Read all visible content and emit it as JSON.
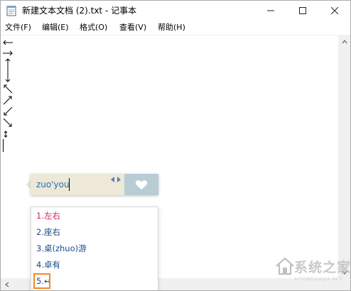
{
  "window": {
    "title": "新建文本文档 (2).txt - 记事本",
    "minimize_icon": "minimize-icon",
    "maximize_icon": "maximize-icon",
    "close_icon": "close-icon"
  },
  "menu": {
    "file": "文件(F)",
    "edit": "编辑(E)",
    "format": "格式(O)",
    "view": "查看(V)",
    "help": "帮助(H)"
  },
  "editor": {
    "lines": [
      "←",
      "→",
      "↕",
      "↖",
      "↗",
      "↙",
      "↘",
      "↕"
    ]
  },
  "ime": {
    "input": "zuo'you",
    "heart_icon": "heart-icon",
    "candidates": [
      "1.左右",
      "2.座右",
      "3.桌(zhuo)游",
      "4.卓有",
      "5.↔"
    ],
    "selected_index": 5
  },
  "watermark": {
    "text": "系统之家",
    "sub": "XITONGZHIJIA.NET"
  },
  "colors": {
    "ime_bar": "#ede8d8",
    "ime_text": "#2a6fb0",
    "candidate_first": "#d8256b",
    "candidate_text": "#1a4a8a",
    "highlight": "#f08a24",
    "heart_box": "#b8ccd3"
  }
}
